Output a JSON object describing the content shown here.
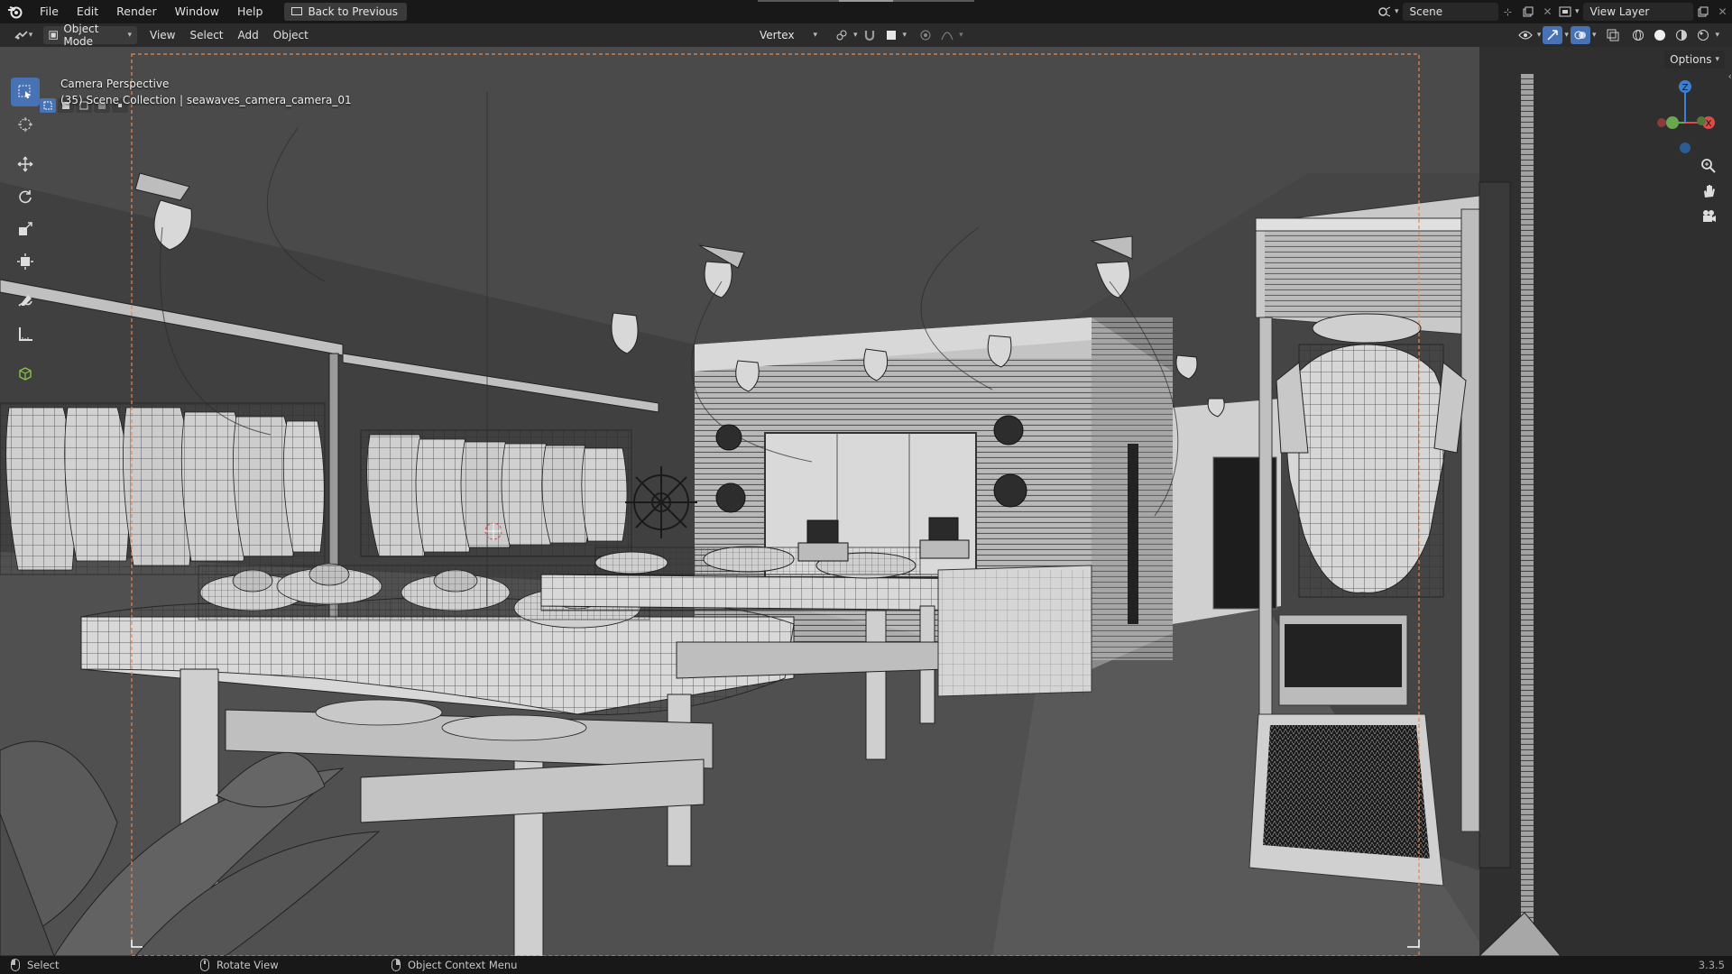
{
  "topbar": {
    "menus": [
      "File",
      "Edit",
      "Render",
      "Window",
      "Help"
    ],
    "back_button": "Back to Previous",
    "scene_name": "Scene",
    "view_layer": "View Layer"
  },
  "header": {
    "mode": "Object Mode",
    "menus": [
      "View",
      "Select",
      "Add",
      "Object"
    ],
    "snap_target": "Vertex",
    "options": "Options"
  },
  "viewport": {
    "camera_label": "Camera Perspective",
    "collection_label": "(35) Scene Collection | seawaves_camera_camera_01",
    "shading": "solid",
    "accent_color": "#4772b3",
    "frame_color": "#e8874a"
  },
  "gizmo": {
    "axes": [
      "Z",
      "X"
    ],
    "colors": {
      "x": "#d94c4c",
      "y": "#6aa84f",
      "z": "#3f7fd0"
    }
  },
  "toolbar": {
    "tools": [
      "select-box-icon",
      "cursor-icon",
      "move-icon",
      "rotate-icon",
      "scale-icon",
      "transform-icon",
      "annotate-icon",
      "measure-icon",
      "add-cube-icon"
    ]
  },
  "statusbar": {
    "select": "Select",
    "rotate_view": "Rotate View",
    "context_menu": "Object Context Menu",
    "version": "3.3.5"
  }
}
